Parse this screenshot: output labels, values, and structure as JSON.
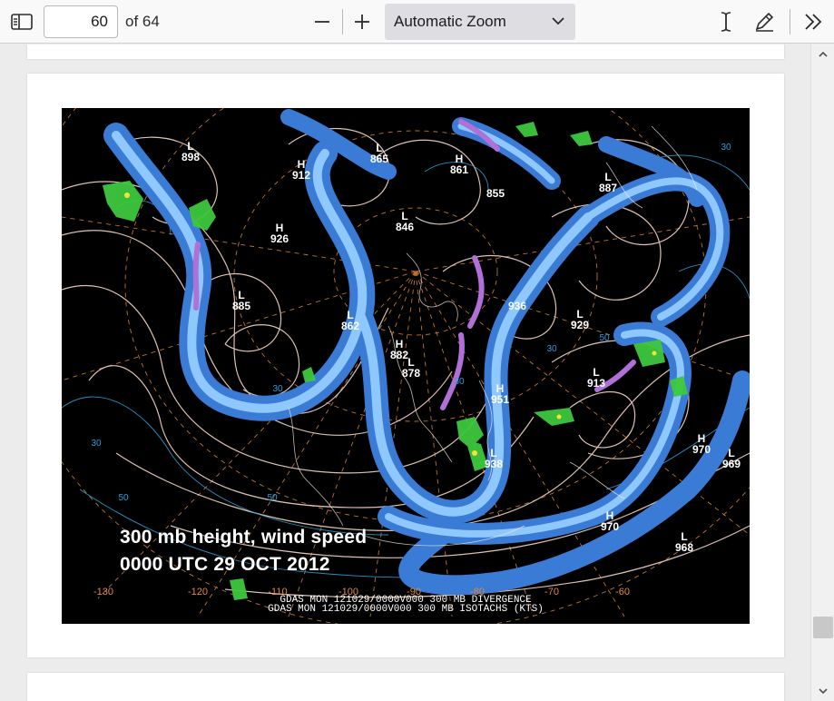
{
  "toolbar": {
    "page_number": "60",
    "page_count": "of 64",
    "zoom_label": "Automatic Zoom",
    "icons": [
      "sidebar-toggle-icon",
      "zoom-out-icon",
      "zoom-in-icon",
      "chevron-down-icon",
      "text-cursor-icon",
      "draw-pen-icon",
      "double-chevron-right-icon"
    ]
  },
  "figure": {
    "caption_line1": "300 mb height, wind speed",
    "caption_line2": "0000 UTC 29 OCT 2012",
    "footer_line1": "GDAS MON 121029/0000V000 300 MB DIVERGENCE",
    "footer_line2": "GDAS MON 121029/0000V000 300 MB ISOTACHS (KTS)",
    "longitudes": [
      "-130",
      "-120",
      "-110",
      "-100",
      "-90",
      "-80",
      "-70",
      "-60"
    ],
    "pressure_labels": [
      {
        "mark": "L",
        "value": "898"
      },
      {
        "mark": "H",
        "value": "912"
      },
      {
        "mark": "L",
        "value": "865"
      },
      {
        "mark": "H",
        "value": "861"
      },
      {
        "mark": "L",
        "value": "846"
      },
      {
        "mark": "H",
        "value": "926"
      },
      {
        "mark": "L",
        "value": "885"
      },
      {
        "mark": "L",
        "value": "862"
      },
      {
        "mark": "H",
        "value": "882"
      },
      {
        "mark": "L",
        "value": "878"
      },
      {
        "mark": "L",
        "value": "929"
      },
      {
        "mark": "L",
        "value": "913"
      },
      {
        "mark": "H",
        "value": "951"
      },
      {
        "mark": "L",
        "value": "938"
      },
      {
        "mark": "H",
        "value": "970"
      },
      {
        "mark": "L",
        "value": "969"
      },
      {
        "mark": "H",
        "value": "970"
      },
      {
        "mark": "L",
        "value": "968"
      },
      {
        "mark": "L",
        "value": "887"
      },
      {
        "mark": "",
        "value": "855"
      },
      {
        "mark": "",
        "value": "936"
      }
    ],
    "isotach_labels": [
      "30",
      "50",
      "30",
      "50",
      "30",
      "30",
      "50",
      "30"
    ],
    "colors": {
      "background": "#000000",
      "jet_outer": "#3a7bd5",
      "jet_inner": "#8fc8ff",
      "jet_core": "#b070d8",
      "contour": "#f5d6c8",
      "isotach": "#2aa0d8",
      "divergence": "#3ec83e",
      "lat_lon": "#e08a3a"
    }
  }
}
